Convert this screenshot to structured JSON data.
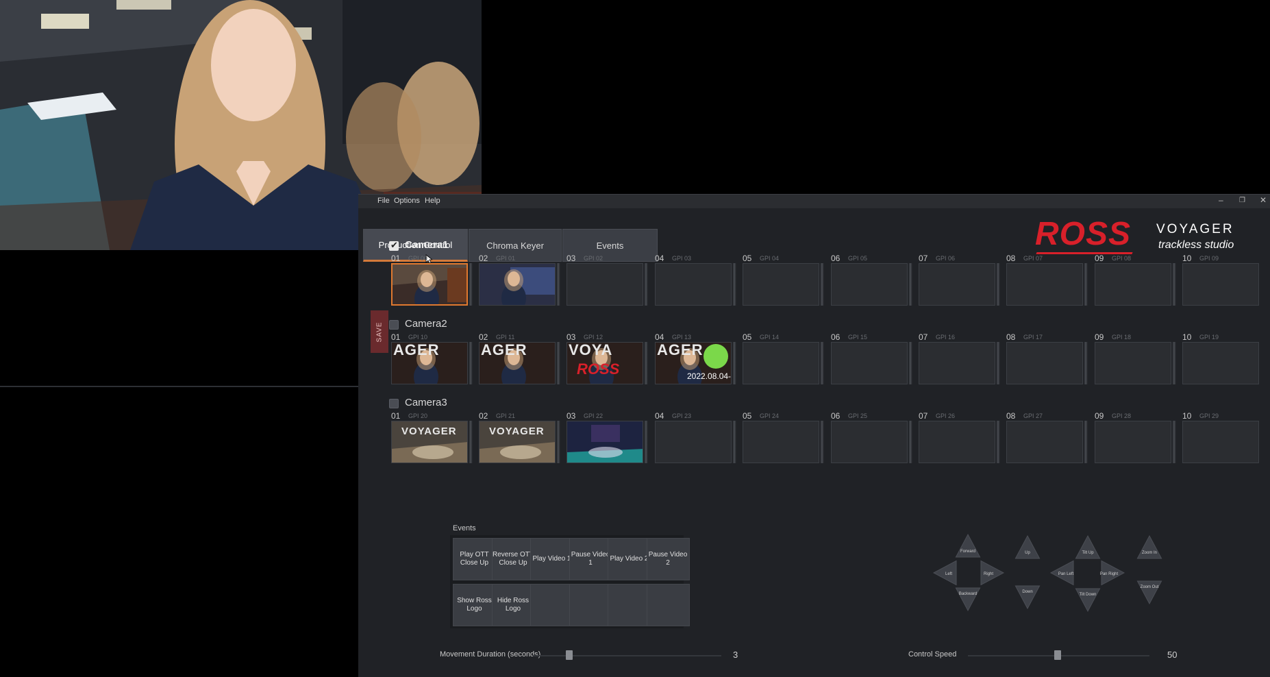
{
  "menu": [
    "File",
    "Options",
    "Help"
  ],
  "window_controls": [
    "–",
    "❐",
    "✕"
  ],
  "tabs": [
    {
      "label": "Production Control",
      "active": true
    },
    {
      "label": "Chroma Keyer",
      "active": false
    },
    {
      "label": "Events",
      "active": false
    }
  ],
  "logo": {
    "ross": "ROSS",
    "voyager": "VOYAGER",
    "sub": "trackless studio"
  },
  "save_label": "SAVE",
  "cameras": [
    {
      "label": "Camera1",
      "checked": true,
      "slots": [
        [
          "01",
          "GPI 00"
        ],
        [
          "02",
          "GPI 01"
        ],
        [
          "03",
          "GPI 02"
        ],
        [
          "04",
          "GPI 03"
        ],
        [
          "05",
          "GPI 04"
        ],
        [
          "06",
          "GPI 05"
        ],
        [
          "07",
          "GPI 06"
        ],
        [
          "08",
          "GPI 07"
        ],
        [
          "09",
          "GPI 08"
        ],
        [
          "10",
          "GPI 09"
        ]
      ]
    },
    {
      "label": "Camera2",
      "checked": false,
      "slots": [
        [
          "01",
          "GPI 10"
        ],
        [
          "02",
          "GPI 11"
        ],
        [
          "03",
          "GPI 12"
        ],
        [
          "04",
          "GPI 13"
        ],
        [
          "05",
          "GPI 14"
        ],
        [
          "06",
          "GPI 15"
        ],
        [
          "07",
          "GPI 16"
        ],
        [
          "08",
          "GPI 17"
        ],
        [
          "09",
          "GPI 18"
        ],
        [
          "10",
          "GPI 19"
        ]
      ]
    },
    {
      "label": "Camera3",
      "checked": false,
      "slots": [
        [
          "01",
          "GPI 20"
        ],
        [
          "02",
          "GPI 21"
        ],
        [
          "03",
          "GPI 22"
        ],
        [
          "04",
          "GPI 23"
        ],
        [
          "05",
          "GPI 24"
        ],
        [
          "06",
          "GPI 25"
        ],
        [
          "07",
          "GPI 26"
        ],
        [
          "08",
          "GPI 27"
        ],
        [
          "09",
          "GPI 28"
        ],
        [
          "10",
          "GPI 29"
        ]
      ]
    }
  ],
  "thumb_text": {
    "ager": "AGER",
    "voya": "VOYA",
    "ross": "ROSS",
    "date": "2022.08.04-",
    "voyager": "VOYAGER"
  },
  "events": {
    "label": "Events",
    "buttons": [
      "Play OTT\nClose Up",
      "Reverse OTT\nClose Up",
      "Play Video 1",
      "Pause Video 1",
      "Play Video 2",
      "Pause Video 2",
      "Show Ross\nLogo",
      "Hide Ross\nLogo",
      "",
      "",
      "",
      ""
    ]
  },
  "movement": {
    "label": "Movement Duration (seconds)",
    "value": "3"
  },
  "speed": {
    "label": "Control Speed",
    "value": "50"
  },
  "dpad": {
    "forward": "Forward",
    "backward": "Backward",
    "left": "Left",
    "right": "Right",
    "up": "Up",
    "down": "Down",
    "tilt_up": "Tilt Up",
    "tilt_down": "Tilt Down",
    "pan_left": "Pan Left",
    "pan_right": "Pan Right",
    "zoom_in": "Zoom In",
    "zoom_out": "Zoom Out"
  },
  "colors": {
    "accent": "#e0792f",
    "ross_red": "#d8202a",
    "background": "#202226"
  }
}
